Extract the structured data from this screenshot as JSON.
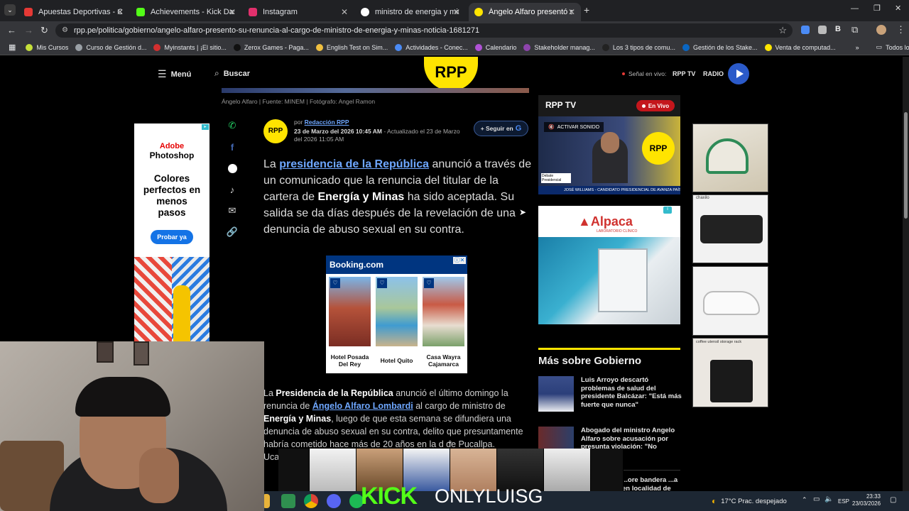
{
  "browser": {
    "tabs": [
      {
        "label": "Apuestas Deportivas - Casa de",
        "color": "#e53935"
      },
      {
        "label": "Achievements - Kick Dashboard",
        "color": "#53fc18"
      },
      {
        "label": "Instagram",
        "color": "#e1306c"
      },
      {
        "label": "ministro de energia y minas an",
        "color": "#ffffff"
      },
      {
        "label": "Ángelo Alfaro presentó su renu",
        "color": "#ffe400"
      }
    ],
    "url": "rpp.pe/politica/gobierno/angelo-alfaro-presento-su-renuncia-al-cargo-de-ministro-de-energia-y-minas-noticia-1681271",
    "bookmarks": [
      {
        "label": "Mis Cursos",
        "color": "#c6e03a"
      },
      {
        "label": "Curso de Gestión d...",
        "color": "#9aa0a6"
      },
      {
        "label": "Myinstants | ¡El sitio...",
        "color": "#d32f2f"
      },
      {
        "label": "Zerox Games - Paga...",
        "color": "#111111"
      },
      {
        "label": "English Test on Sim...",
        "color": "#f0c040"
      },
      {
        "label": "Actividades - Conec...",
        "color": "#4b8bf5"
      },
      {
        "label": "Calendario",
        "color": "#b052d6"
      },
      {
        "label": "Stakeholder manag...",
        "color": "#8e44ad"
      },
      {
        "label": "Los 3 tipos de comu...",
        "color": "#222222"
      },
      {
        "label": "Gestión de los Stake...",
        "color": "#0a66c2"
      },
      {
        "label": "Venta de computad...",
        "color": "#ffe600"
      }
    ],
    "all_bookmarks": "Todos los favoritos"
  },
  "site": {
    "menu": "Menú",
    "search": "Buscar",
    "logo": "RPP",
    "live_label": "Señal en vivo:",
    "rpp_tv": "RPP TV",
    "radio": "RADIO"
  },
  "article": {
    "caption": "Ángelo Alfaro | Fuente: MINEM | Fotógrafo: Angel Ramon",
    "by": "por",
    "author": "Redacción RPP",
    "date": "23 de Marzo del 2026 10:45 AM",
    "updated": "- Actualizado el 23 de Marzo del 2026 11:05 AM",
    "follow": "+ Seguir en",
    "lead_1": "La ",
    "lead_link": "presidencia de la República",
    "lead_2": " anunció a través de un comunicado que la renuncia del titular de la cartera de ",
    "lead_bold": "Energía y Minas",
    "lead_3": " ha sido aceptada. Su salida se da días después de la revelación de una denuncia de abuso sexual en su contra.",
    "p2_1": "La ",
    "p2_bold1": "Presidencia de la República",
    "p2_2": " anunció el último domingo la renuncia de ",
    "p2_link": "Ángelo Alfaro Lombardi",
    "p2_3": " al cargo de ministro de ",
    "p2_bold2": "Energía y Minas",
    "p2_4": ", luego de que esta semana se difundiera una denuncia de abuso sexual en su contra, delito que presuntamente habría cometido hace más de 20 años en la",
    "p2_5": "d de Pucallpa.",
    "p2_6": "Uca"
  },
  "ads": {
    "adobe_title": "Adobe",
    "adobe_product": "Photoshop",
    "adobe_tagline": "Colores perfectos en menos pasos",
    "adobe_cta": "Probar ya",
    "booking": "Booking.com",
    "hotels": [
      "Hotel Posada Del Rey",
      "Hotel Quito",
      "Casa Wayra Cajamarca"
    ],
    "alpaca": "Alpaca",
    "alpaca_sub": "LABORATORIO CLÍNICO",
    "coffee_brand": "chaxilo",
    "coffee_rack": "coffee utensil storage rack"
  },
  "sidebar": {
    "tv_title": "RPP TV",
    "en_vivo": "En Vivo",
    "activar": "ACTIVAR SONIDO",
    "tv_lower": "JOSÉ WILLIAMS - CANDIDATO PRESIDENCIAL DE AVANZA PAÍS",
    "debate": "Debate Presidencial",
    "mas_title": "Más sobre Gobierno",
    "news": [
      "Luis Arroyo descartó problemas de salud del presidente Balcázar: \"Está más fuerte que nunca\"",
      "Abogado del ministro Angelo Alfaro sobre acusación por presunta violación: \"No existe...",
      "...ore bandera ...a en localidad de"
    ]
  },
  "stream": {
    "kick": "KICK",
    "channel": "ONLYLUISG"
  },
  "taskbar": {
    "weather": "17°C  Prac. despejado",
    "lang": "ESP",
    "time": "23:33",
    "date": "23/03/2026"
  }
}
